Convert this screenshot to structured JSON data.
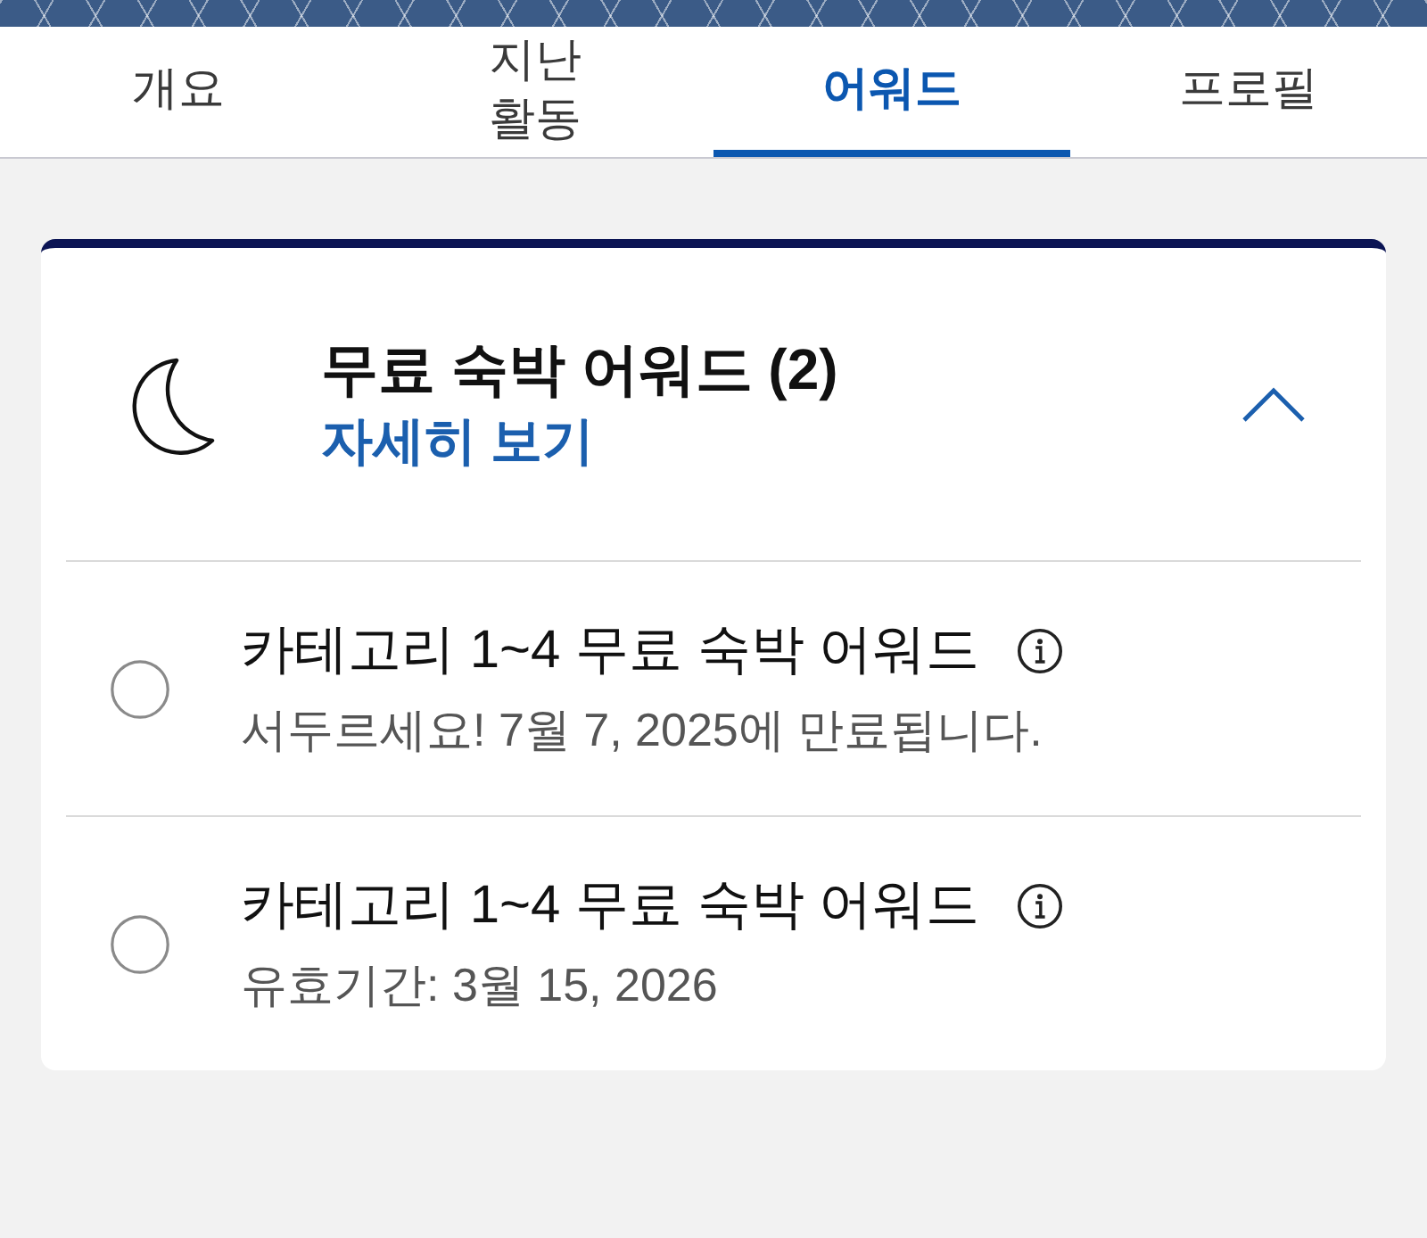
{
  "tabs": [
    {
      "label": "개요",
      "selected": false
    },
    {
      "label": "지난 활동",
      "selected": false
    },
    {
      "label": "어워드",
      "selected": true
    },
    {
      "label": "프로필",
      "selected": false
    }
  ],
  "award_section": {
    "title": "무료 숙박 어워드 (2)",
    "link": "자세히 보기",
    "expanded": true,
    "items": [
      {
        "title": "카테고리 1~4 무료 숙박 어워드",
        "subtitle": "서두르세요! 7월 7, 2025에 만료됩니다.",
        "selected": false
      },
      {
        "title": "카테고리 1~4 무료 숙박 어워드",
        "subtitle": "유효기간: 3월 15, 2026",
        "selected": false
      }
    ]
  }
}
